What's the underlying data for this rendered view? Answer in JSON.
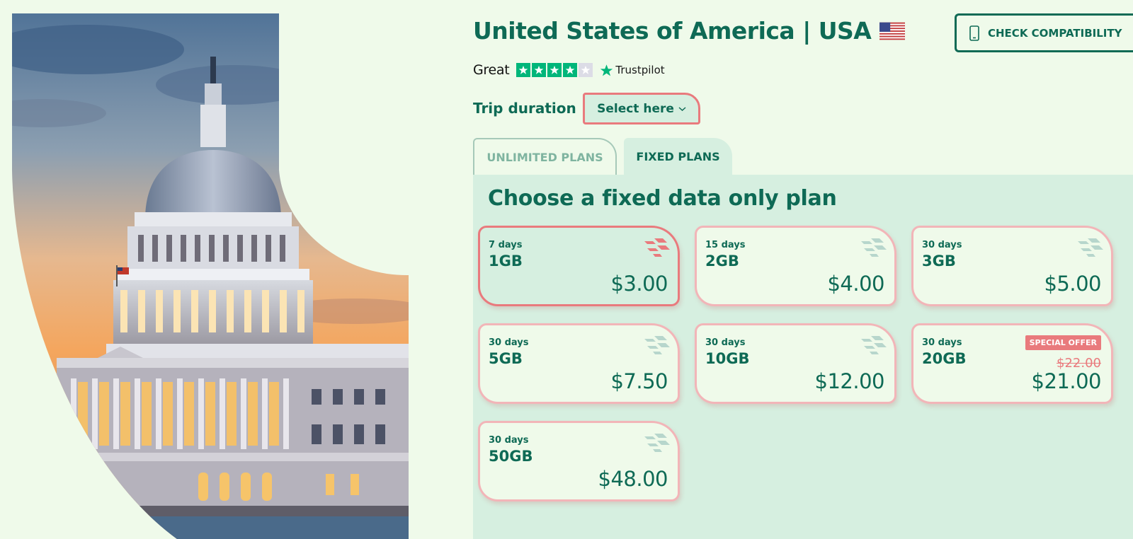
{
  "hero": {
    "image_name": "us-capitol-building-at-sunset"
  },
  "header": {
    "title": "United States of America | USA",
    "flag_icon": "us-flag-icon",
    "check_button_label": "CHECK COMPATIBILITY",
    "check_button_icon": "phone-icon"
  },
  "rating": {
    "word": "Great",
    "stars_filled": 4,
    "stars_total": 5,
    "provider": "Trustpilot"
  },
  "trip": {
    "label": "Trip duration",
    "select_label": "Select here"
  },
  "tabs": [
    {
      "label": "UNLIMITED PLANS",
      "active": false
    },
    {
      "label": "FIXED PLANS",
      "active": true
    }
  ],
  "panel": {
    "title": "Choose a fixed data only plan",
    "plans": [
      {
        "days": "7 days",
        "data": "1GB",
        "price": "$3.00",
        "selected": true
      },
      {
        "days": "15 days",
        "data": "2GB",
        "price": "$4.00"
      },
      {
        "days": "30 days",
        "data": "3GB",
        "price": "$5.00"
      },
      {
        "days": "30 days",
        "data": "5GB",
        "price": "$7.50"
      },
      {
        "days": "30 days",
        "data": "10GB",
        "price": "$12.00"
      },
      {
        "days": "30 days",
        "data": "20GB",
        "price": "$21.00",
        "old_price": "$22.00",
        "badge": "SPECIAL OFFER"
      },
      {
        "days": "30 days",
        "data": "50GB",
        "price": "$48.00"
      }
    ]
  },
  "colors": {
    "background": "#effaea",
    "primary_green": "#0e6a55",
    "panel_green": "#d6efe0",
    "accent_coral": "#e97a7d",
    "trustpilot_green": "#00b67a"
  }
}
